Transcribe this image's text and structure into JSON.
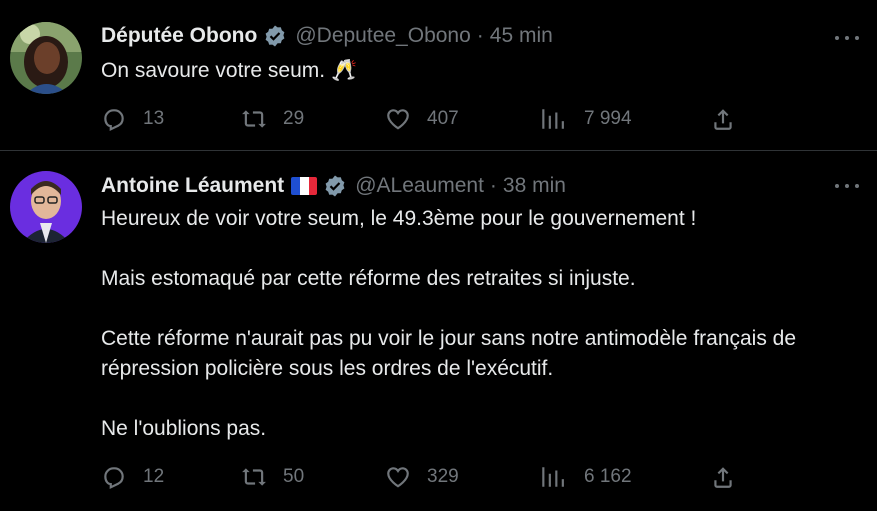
{
  "colors": {
    "background": "#000000",
    "text_primary": "#e7e9ea",
    "text_secondary": "#71767b",
    "divider": "#2f3336",
    "verified_badge": "#829aab"
  },
  "tweets": [
    {
      "author_name": "Députée Obono",
      "verified_icon": "verified-badge-icon",
      "handle": "@Deputee_Obono",
      "separator": "·",
      "time": "45 min",
      "text_lines": [
        "On savoure votre seum."
      ],
      "emoji": "🥂",
      "stats": {
        "replies": "13",
        "retweets": "29",
        "likes": "407",
        "views": "7 994"
      }
    },
    {
      "author_name": "Antoine Léaument",
      "flag_icon": "france-flag-icon",
      "verified_icon": "verified-badge-icon",
      "handle": "@ALeaument",
      "separator": "·",
      "time": "38 min",
      "paragraphs": [
        "Heureux de voir votre seum, le 49.3ème pour le gouvernement !",
        "Mais estomaqué par cette réforme des retraites si injuste.",
        "Cette réforme n'aurait pas pu voir le jour sans notre antimodèle français de répression policière sous les ordres de l'exécutif.",
        "Ne l'oublions pas."
      ],
      "stats": {
        "replies": "12",
        "retweets": "50",
        "likes": "329",
        "views": "6 162"
      }
    }
  ]
}
